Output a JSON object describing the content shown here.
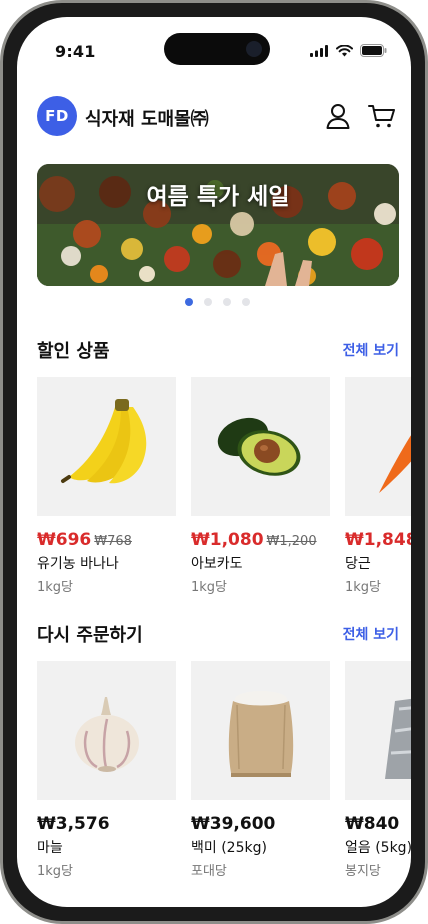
{
  "status_bar": {
    "time": "9:41"
  },
  "header": {
    "logo_text": "FD",
    "shop_name": "식자재 도매몰㈜",
    "profile_icon": "user-icon",
    "cart_icon": "cart-icon"
  },
  "banner": {
    "title": "여름 특가 세일",
    "page_count": 4,
    "active_page": 1
  },
  "sale_section": {
    "title": "할인 상품",
    "see_all": "전체 보기",
    "items": [
      {
        "price": "₩696",
        "old_price": "₩768",
        "name": "유기농 바나나",
        "unit": "1kg당"
      },
      {
        "price": "₩1,080",
        "old_price": "₩1,200",
        "name": "아보카도",
        "unit": "1kg당"
      },
      {
        "price": "₩1,848",
        "old_price": "",
        "name": "당근",
        "unit": "1kg당"
      }
    ]
  },
  "reorder_section": {
    "title": "다시 주문하기",
    "see_all": "전체 보기",
    "items": [
      {
        "price": "₩3,576",
        "name": "마늘",
        "unit": "1kg당"
      },
      {
        "price": "₩39,600",
        "name": "백미 (25kg)",
        "unit": "포대당"
      },
      {
        "price": "₩840",
        "name": "얼음 (5kg)",
        "unit": "봉지당"
      }
    ]
  },
  "colors": {
    "accent": "#3d5fe6",
    "sale_price": "#d92b2b"
  }
}
